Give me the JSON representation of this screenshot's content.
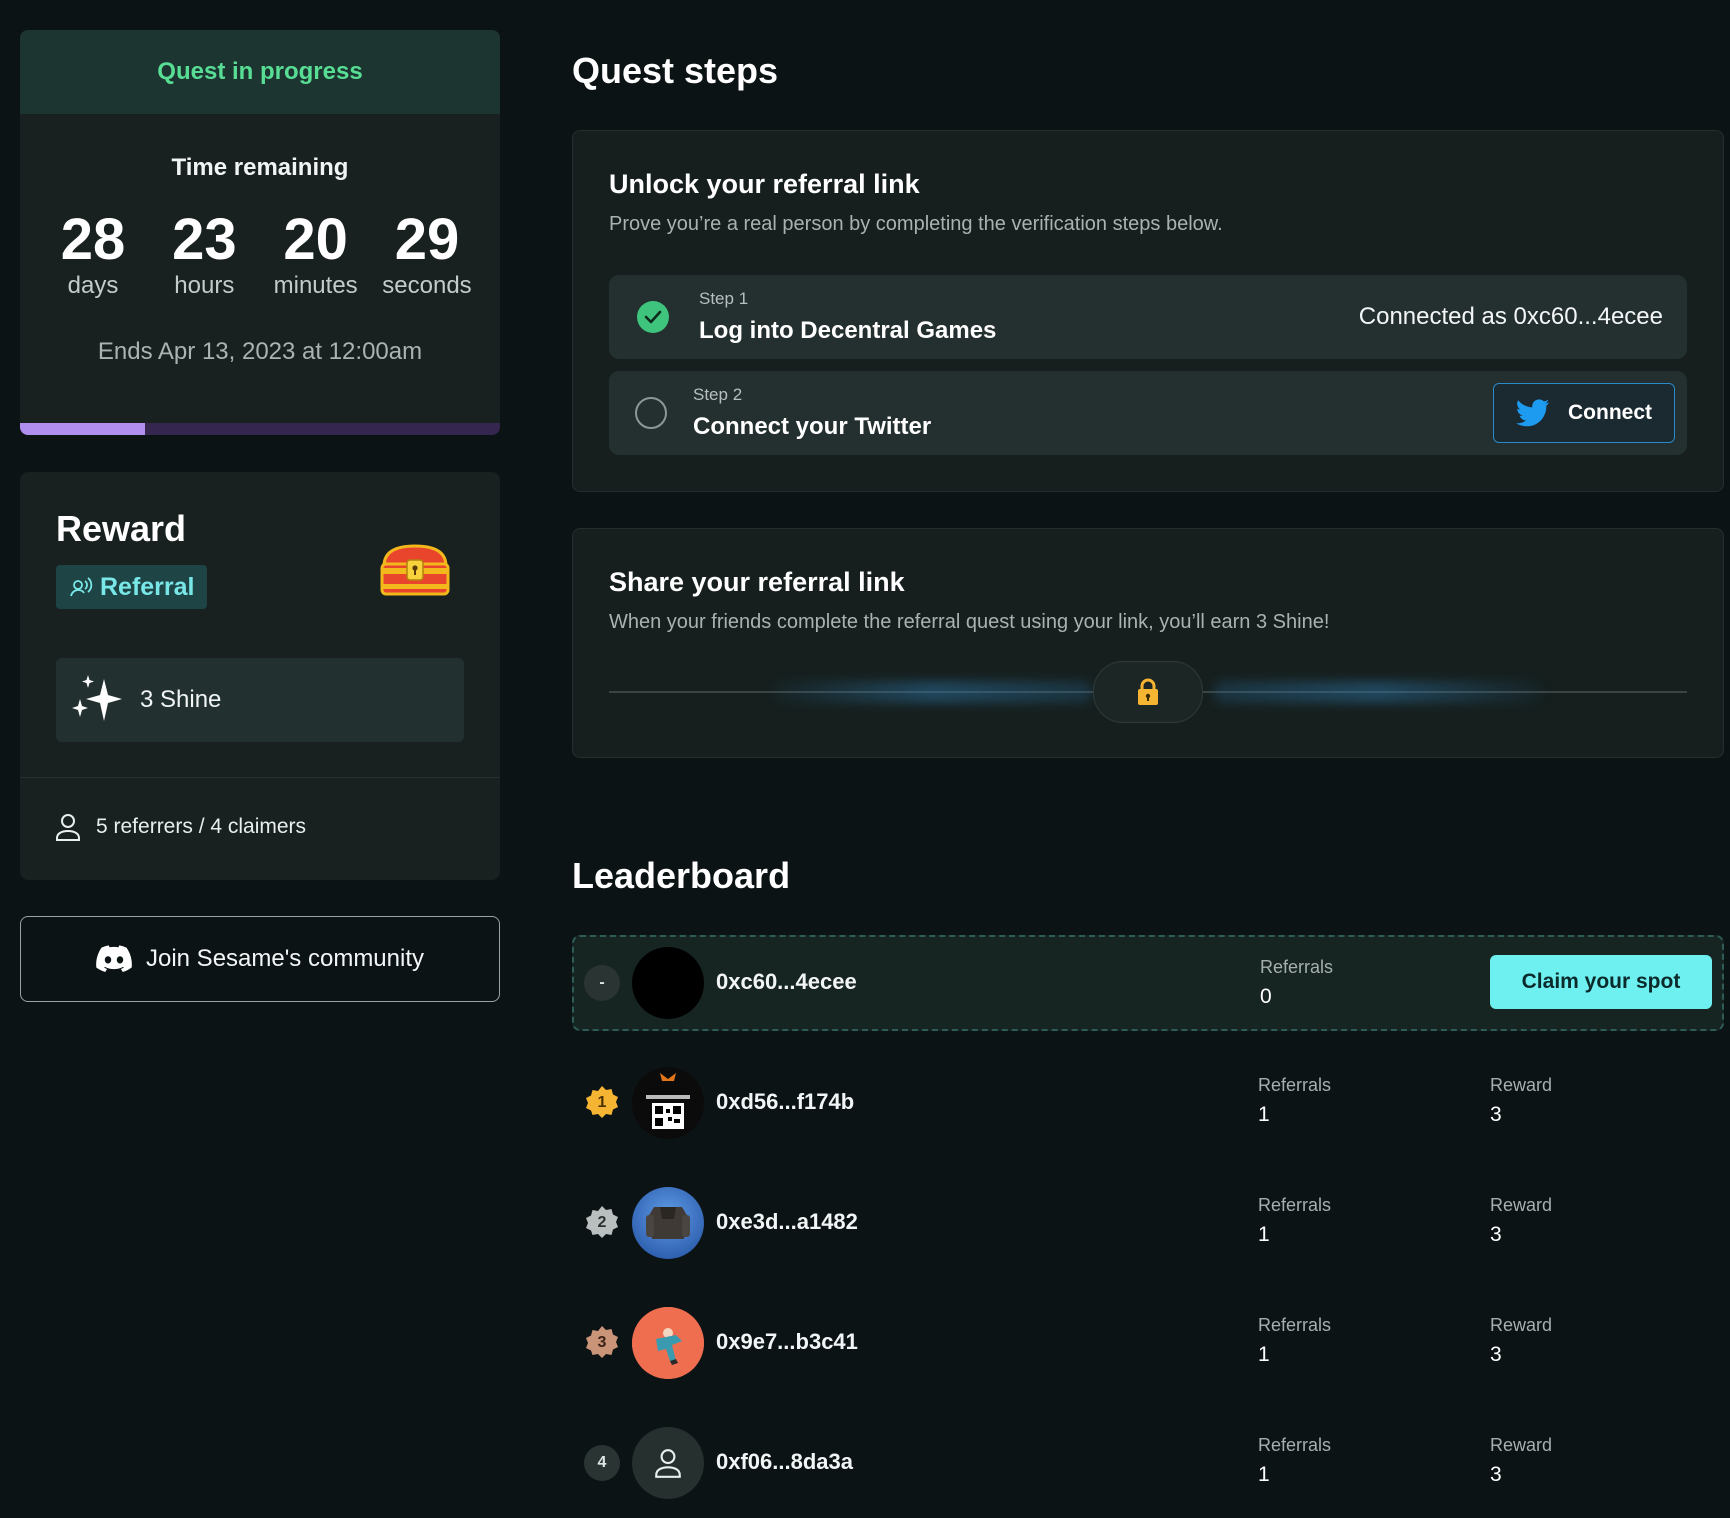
{
  "quest": {
    "status": "Quest in progress",
    "time_title": "Time remaining",
    "countdown": [
      {
        "value": "28",
        "label": "days"
      },
      {
        "value": "23",
        "label": "hours"
      },
      {
        "value": "20",
        "label": "minutes"
      },
      {
        "value": "29",
        "label": "seconds"
      }
    ],
    "ends": "Ends Apr 13, 2023 at 12:00am",
    "progress_percent": 26
  },
  "reward": {
    "title": "Reward",
    "type_label": "Referral",
    "amount": "3 Shine",
    "stats": "5 referrers / 4 claimers",
    "chest_icon": "treasure-chest-icon"
  },
  "community": {
    "label": "Join Sesame's community",
    "icon": "discord-icon"
  },
  "steps_section": {
    "title": "Quest steps",
    "unlock": {
      "title": "Unlock your referral link",
      "subtitle": "Prove you’re a real person by completing the verification steps below.",
      "steps": [
        {
          "step": "Step 1",
          "title": "Log into Decentral Games",
          "status": "Connected as 0xc60...4ecee",
          "done": true
        },
        {
          "step": "Step 2",
          "title": "Connect your Twitter",
          "action": "Connect",
          "done": false
        }
      ]
    },
    "share": {
      "title": "Share your referral link",
      "subtitle": "When your friends complete the referral quest using your link, you’ll earn 3 Shine!"
    }
  },
  "leaderboard": {
    "title": "Leaderboard",
    "me": {
      "rank": "-",
      "address": "0xc60...4ecee",
      "referrals_label": "Referrals",
      "referrals": "0",
      "action": "Claim your spot"
    },
    "rows": [
      {
        "rank": "1",
        "address": "0xd56...f174b",
        "referrals_label": "Referrals",
        "referrals": "1",
        "reward_label": "Reward",
        "reward": "3",
        "badge_color": "#f5b431"
      },
      {
        "rank": "2",
        "address": "0xe3d...a1482",
        "referrals_label": "Referrals",
        "referrals": "1",
        "reward_label": "Reward",
        "reward": "3",
        "badge_color": "#b9bfbf"
      },
      {
        "rank": "3",
        "address": "0x9e7...b3c41",
        "referrals_label": "Referrals",
        "referrals": "1",
        "reward_label": "Reward",
        "reward": "3",
        "badge_color": "#c99478"
      },
      {
        "rank": "4",
        "address": "0xf06...8da3a",
        "referrals_label": "Referrals",
        "referrals": "1",
        "reward_label": "Reward",
        "reward": "3",
        "badge_color": ""
      }
    ]
  },
  "colors": {
    "background": "#0c1315",
    "accent_green": "#58dd95",
    "accent_cyan": "#6ef0f0",
    "progress": "#b08ef0",
    "twitter_blue": "#1d9bf0"
  }
}
